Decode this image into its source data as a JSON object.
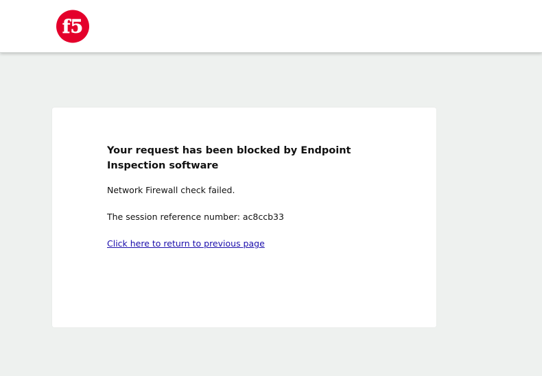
{
  "header": {
    "logo_text": "f5",
    "logo_color": "#e4002b"
  },
  "card": {
    "title": "Your request has been blocked by Endpoint Inspection software",
    "message": "Network Firewall check failed.",
    "reference_label": "The session reference number:",
    "reference_number": "ac8ccb33",
    "return_link": "Click here to return to previous page"
  },
  "colors": {
    "page_background": "#eef1ef",
    "card_background": "#ffffff",
    "link": "#1a0dab"
  }
}
